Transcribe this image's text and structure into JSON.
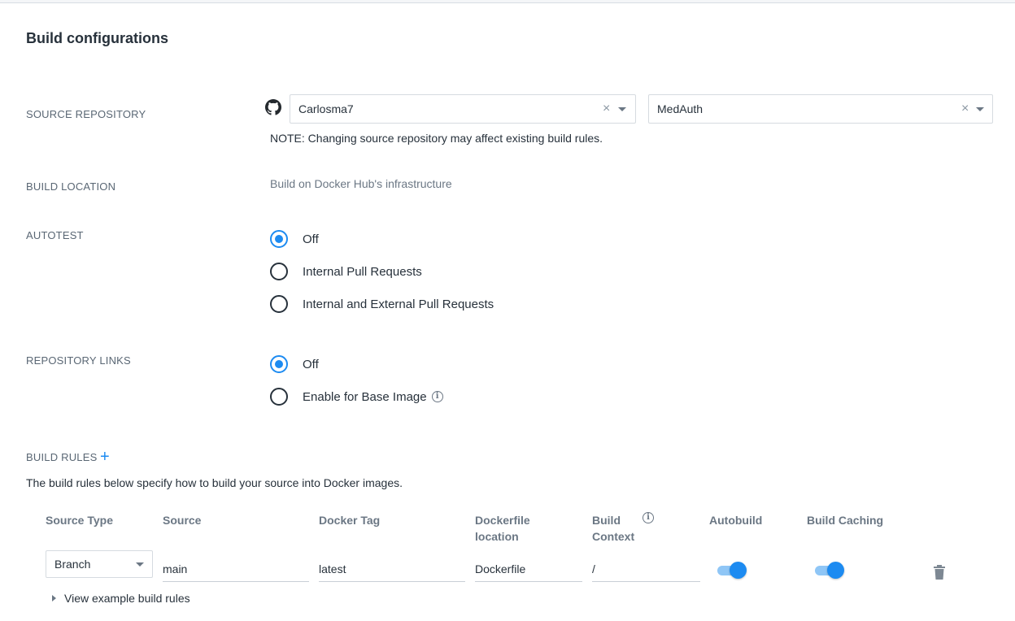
{
  "page": {
    "title": "Build configurations"
  },
  "source_repository": {
    "label": "SOURCE REPOSITORY",
    "provider_icon": "github-icon",
    "organization": "Carlosma7",
    "repository": "MedAuth",
    "clear_glyph": "×",
    "note": "NOTE: Changing source repository may affect existing build rules."
  },
  "build_location": {
    "label": "BUILD LOCATION",
    "value": "Build on Docker Hub's infrastructure"
  },
  "autotest": {
    "label": "AUTOTEST",
    "options": [
      "Off",
      "Internal Pull Requests",
      "Internal and External Pull Requests"
    ],
    "selected": "Off"
  },
  "repository_links": {
    "label": "REPOSITORY LINKS",
    "options": [
      "Off",
      "Enable for Base Image"
    ],
    "selected": "Off"
  },
  "build_rules": {
    "label": "BUILD RULES",
    "add_glyph": "+",
    "description": "The build rules below specify how to build your source into Docker images.",
    "columns": {
      "source_type": "Source Type",
      "source": "Source",
      "docker_tag": "Docker Tag",
      "dockerfile_location_1": "Dockerfile",
      "dockerfile_location_2": "location",
      "build_context_1": "Build",
      "build_context_2": "Context",
      "autobuild": "Autobuild",
      "build_caching": "Build Caching"
    },
    "rule": {
      "source_type": "Branch",
      "source": "main",
      "docker_tag": "latest",
      "dockerfile_location": "Dockerfile",
      "build_context": "/",
      "autobuild": true,
      "build_caching": true
    },
    "view_examples": "View example build rules"
  },
  "colors": {
    "accent": "#1d8bf1",
    "text": "#27313b",
    "muted": "#6b7784"
  }
}
